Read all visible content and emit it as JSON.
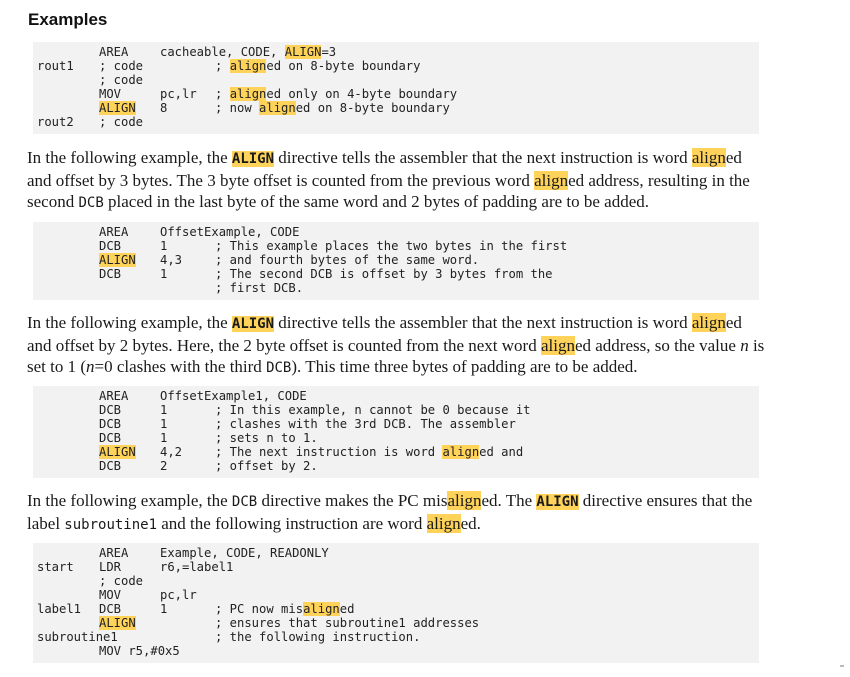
{
  "heading": "Examples",
  "blocks": {
    "b1": [
      {
        "label": "",
        "op": "AREA",
        "opHl": false,
        "args": "cacheable, CODE, ",
        "argsHl": "ALIGN",
        "argsRest": "=3",
        "comment": ""
      },
      {
        "label": "rout1",
        "op": "; code",
        "opHl": false,
        "args": "",
        "argsHl": "",
        "argsRest": "",
        "comment": "; aligned on 8-byte boundary"
      },
      {
        "label": "",
        "op": "; code",
        "opHl": false,
        "args": "",
        "argsHl": "",
        "argsRest": "",
        "comment": ""
      },
      {
        "label": "",
        "op": "MOV",
        "opHl": false,
        "args": "pc,lr",
        "argsHl": "",
        "argsRest": "",
        "comment": "; aligned only on 4-byte boundary"
      },
      {
        "label": "",
        "op": "ALIGN",
        "opHl": true,
        "args": "8",
        "argsHl": "",
        "argsRest": "",
        "comment": "; now aligned on 8-byte boundary"
      },
      {
        "label": "rout2",
        "op": "; code",
        "opHl": false,
        "args": "",
        "argsHl": "",
        "argsRest": "",
        "comment": ""
      }
    ],
    "b2": [
      {
        "op": "AREA",
        "args": "OffsetExample, CODE",
        "comment": ""
      },
      {
        "op": "DCB",
        "args": "1",
        "comment": "; This example places the two bytes in the first"
      },
      {
        "op": "ALIGN",
        "args": "4,3",
        "comment": "; and fourth bytes of the same word."
      },
      {
        "op": "DCB",
        "args": "1",
        "comment": "; The second DCB is offset by 3 bytes from the"
      },
      {
        "op": "",
        "args": "",
        "comment": "; first DCB."
      }
    ],
    "b3": [
      {
        "op": "AREA",
        "args": "OffsetExample1, CODE",
        "comment": ""
      },
      {
        "op": "DCB",
        "args": "1",
        "comment": "; In this example, n cannot be 0 because it"
      },
      {
        "op": "DCB",
        "args": "1",
        "comment": "; clashes with the 3rd DCB. The assembler"
      },
      {
        "op": "DCB",
        "args": "1",
        "comment": "; sets n to 1."
      },
      {
        "op": "ALIGN",
        "args": "4,2",
        "comment": "; The next instruction is word aligned and"
      },
      {
        "op": "DCB",
        "args": "2",
        "comment": "; offset by 2."
      }
    ],
    "b4": [
      {
        "label": "",
        "op": "AREA",
        "args": "Example, CODE, READONLY",
        "comment": ""
      },
      {
        "label": "start",
        "op": "LDR",
        "args": "r6,=label1",
        "comment": ""
      },
      {
        "label": "",
        "op": "; code",
        "args": "",
        "comment": ""
      },
      {
        "label": "",
        "op": "MOV",
        "args": "pc,lr",
        "comment": ""
      },
      {
        "label": "label1",
        "op": "DCB",
        "args": "1",
        "comment": "; PC now misaligned"
      },
      {
        "label": "",
        "op": "ALIGN",
        "args": "",
        "comment": "; ensures that subroutine1 addresses"
      },
      {
        "label": "subroutine1",
        "op": "",
        "args": "",
        "comment": "; the following instruction."
      },
      {
        "label": "",
        "op": "MOV r5,#0x5",
        "args": "",
        "comment": ""
      }
    ]
  },
  "para1": {
    "a": "In the following example, the ",
    "kw": "ALIGN",
    "b": " directive tells the assembler that the next instruction is word ",
    "hl1": "align",
    "c": "ed and offset by 3 bytes. The 3 byte offset is counted from the previous word ",
    "hl2": "align",
    "d": "ed address, resulting in the second ",
    "code": "DCB",
    "e": " placed in the last byte of the same word and 2 bytes of padding are to be added."
  },
  "para2": {
    "a": "In the following example, the ",
    "kw": "ALIGN",
    "b": " directive tells the assembler that the next instruction is word ",
    "hl1": "align",
    "c": "ed and offset by 2 bytes. Here, the 2 byte offset is counted from the next word ",
    "hl2": "align",
    "d": "ed address, so the value ",
    "n1": "n",
    "e": " is set to 1 (",
    "n2": "n",
    "f": "=0 clashes with the third ",
    "code": "DCB",
    "g": "). This time three bytes of padding are to be added."
  },
  "para3": {
    "a": "In the following example, the ",
    "code1": "DCB",
    "b": " directive makes the PC mis",
    "hl1": "align",
    "c": "ed. The ",
    "kw": "ALIGN",
    "d": " directive ensures that the label ",
    "code2": "subroutine1",
    "e": " and the following instruction are word ",
    "hl2": "align",
    "f": "ed."
  }
}
